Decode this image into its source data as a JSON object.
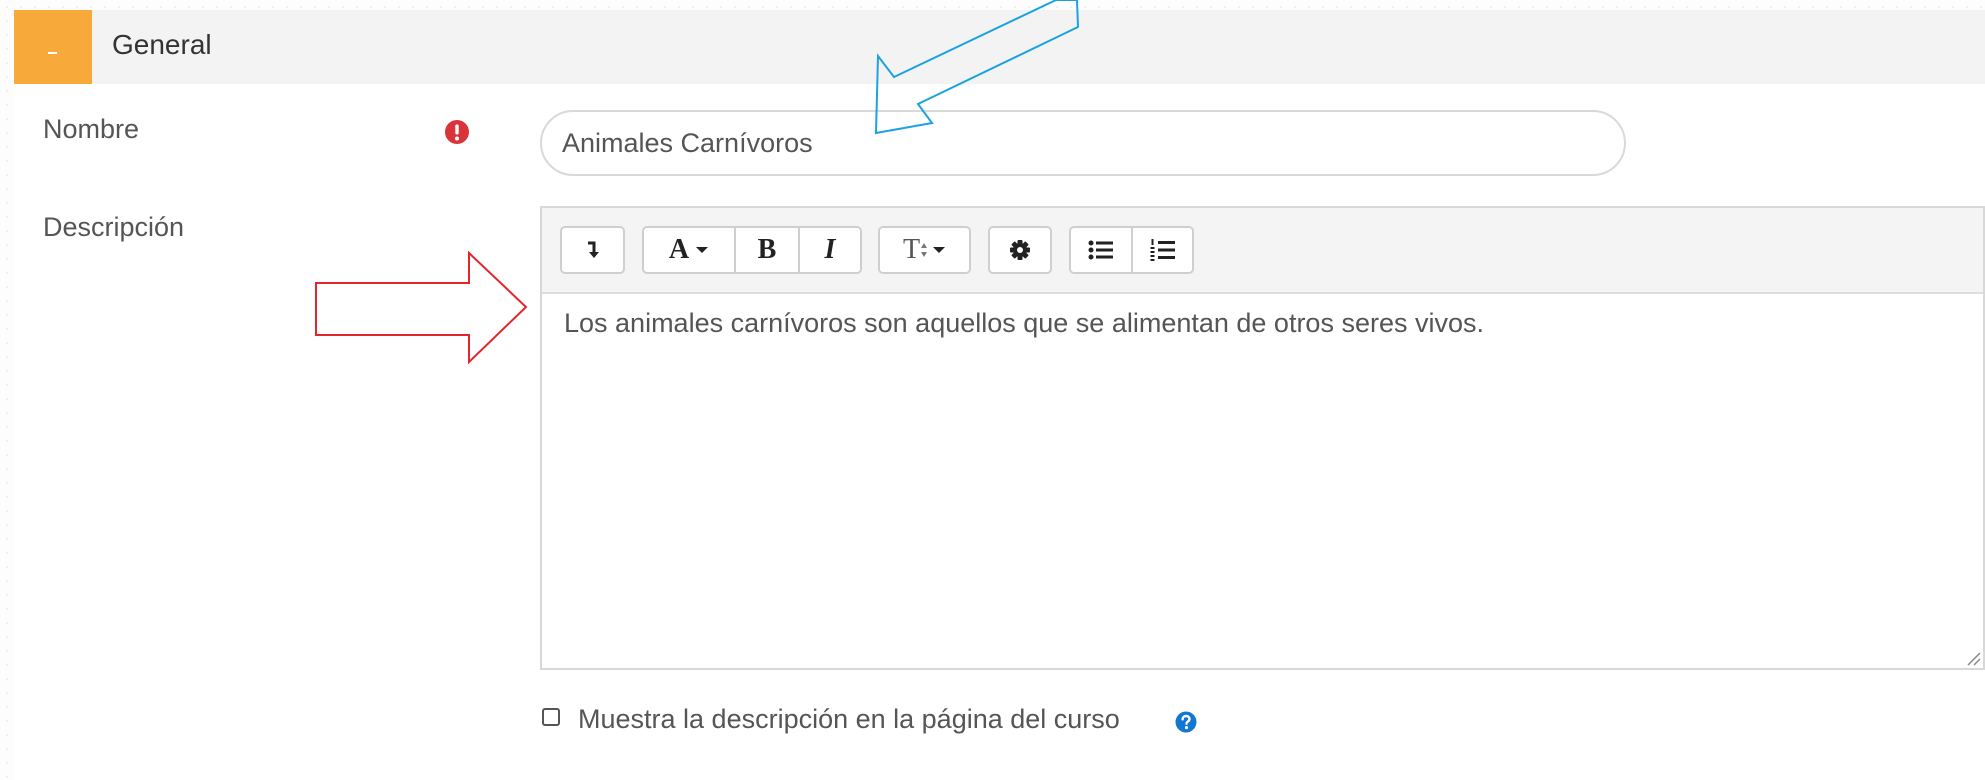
{
  "section": {
    "title": "General",
    "toggle_symbol": "–"
  },
  "fields": {
    "name": {
      "label": "Nombre",
      "value": "Animales Carnívoros",
      "required_icon": "exclamation-circle-icon"
    },
    "description": {
      "label": "Descripción",
      "content": "Los animales carnívoros son aquellos que se alimentan de otros seres vivos.",
      "toolbar": [
        "collapse-icon",
        "font-color-icon",
        "bold-icon",
        "italic-icon",
        "font-size-icon",
        "settings-icon",
        "unordered-list-icon",
        "ordered-list-icon"
      ],
      "toolbar_text": {
        "font_color": "A",
        "bold": "B",
        "italic": "I",
        "font_size": "T"
      }
    }
  },
  "show_description": {
    "label": "Muestra la descripción en la página del curso",
    "checked": false
  },
  "colors": {
    "accent": "#f7a93a",
    "required": "#d9343a",
    "help": "#1177d1",
    "annotation_blue": "#1aa3df",
    "annotation_red": "#e3262b"
  }
}
